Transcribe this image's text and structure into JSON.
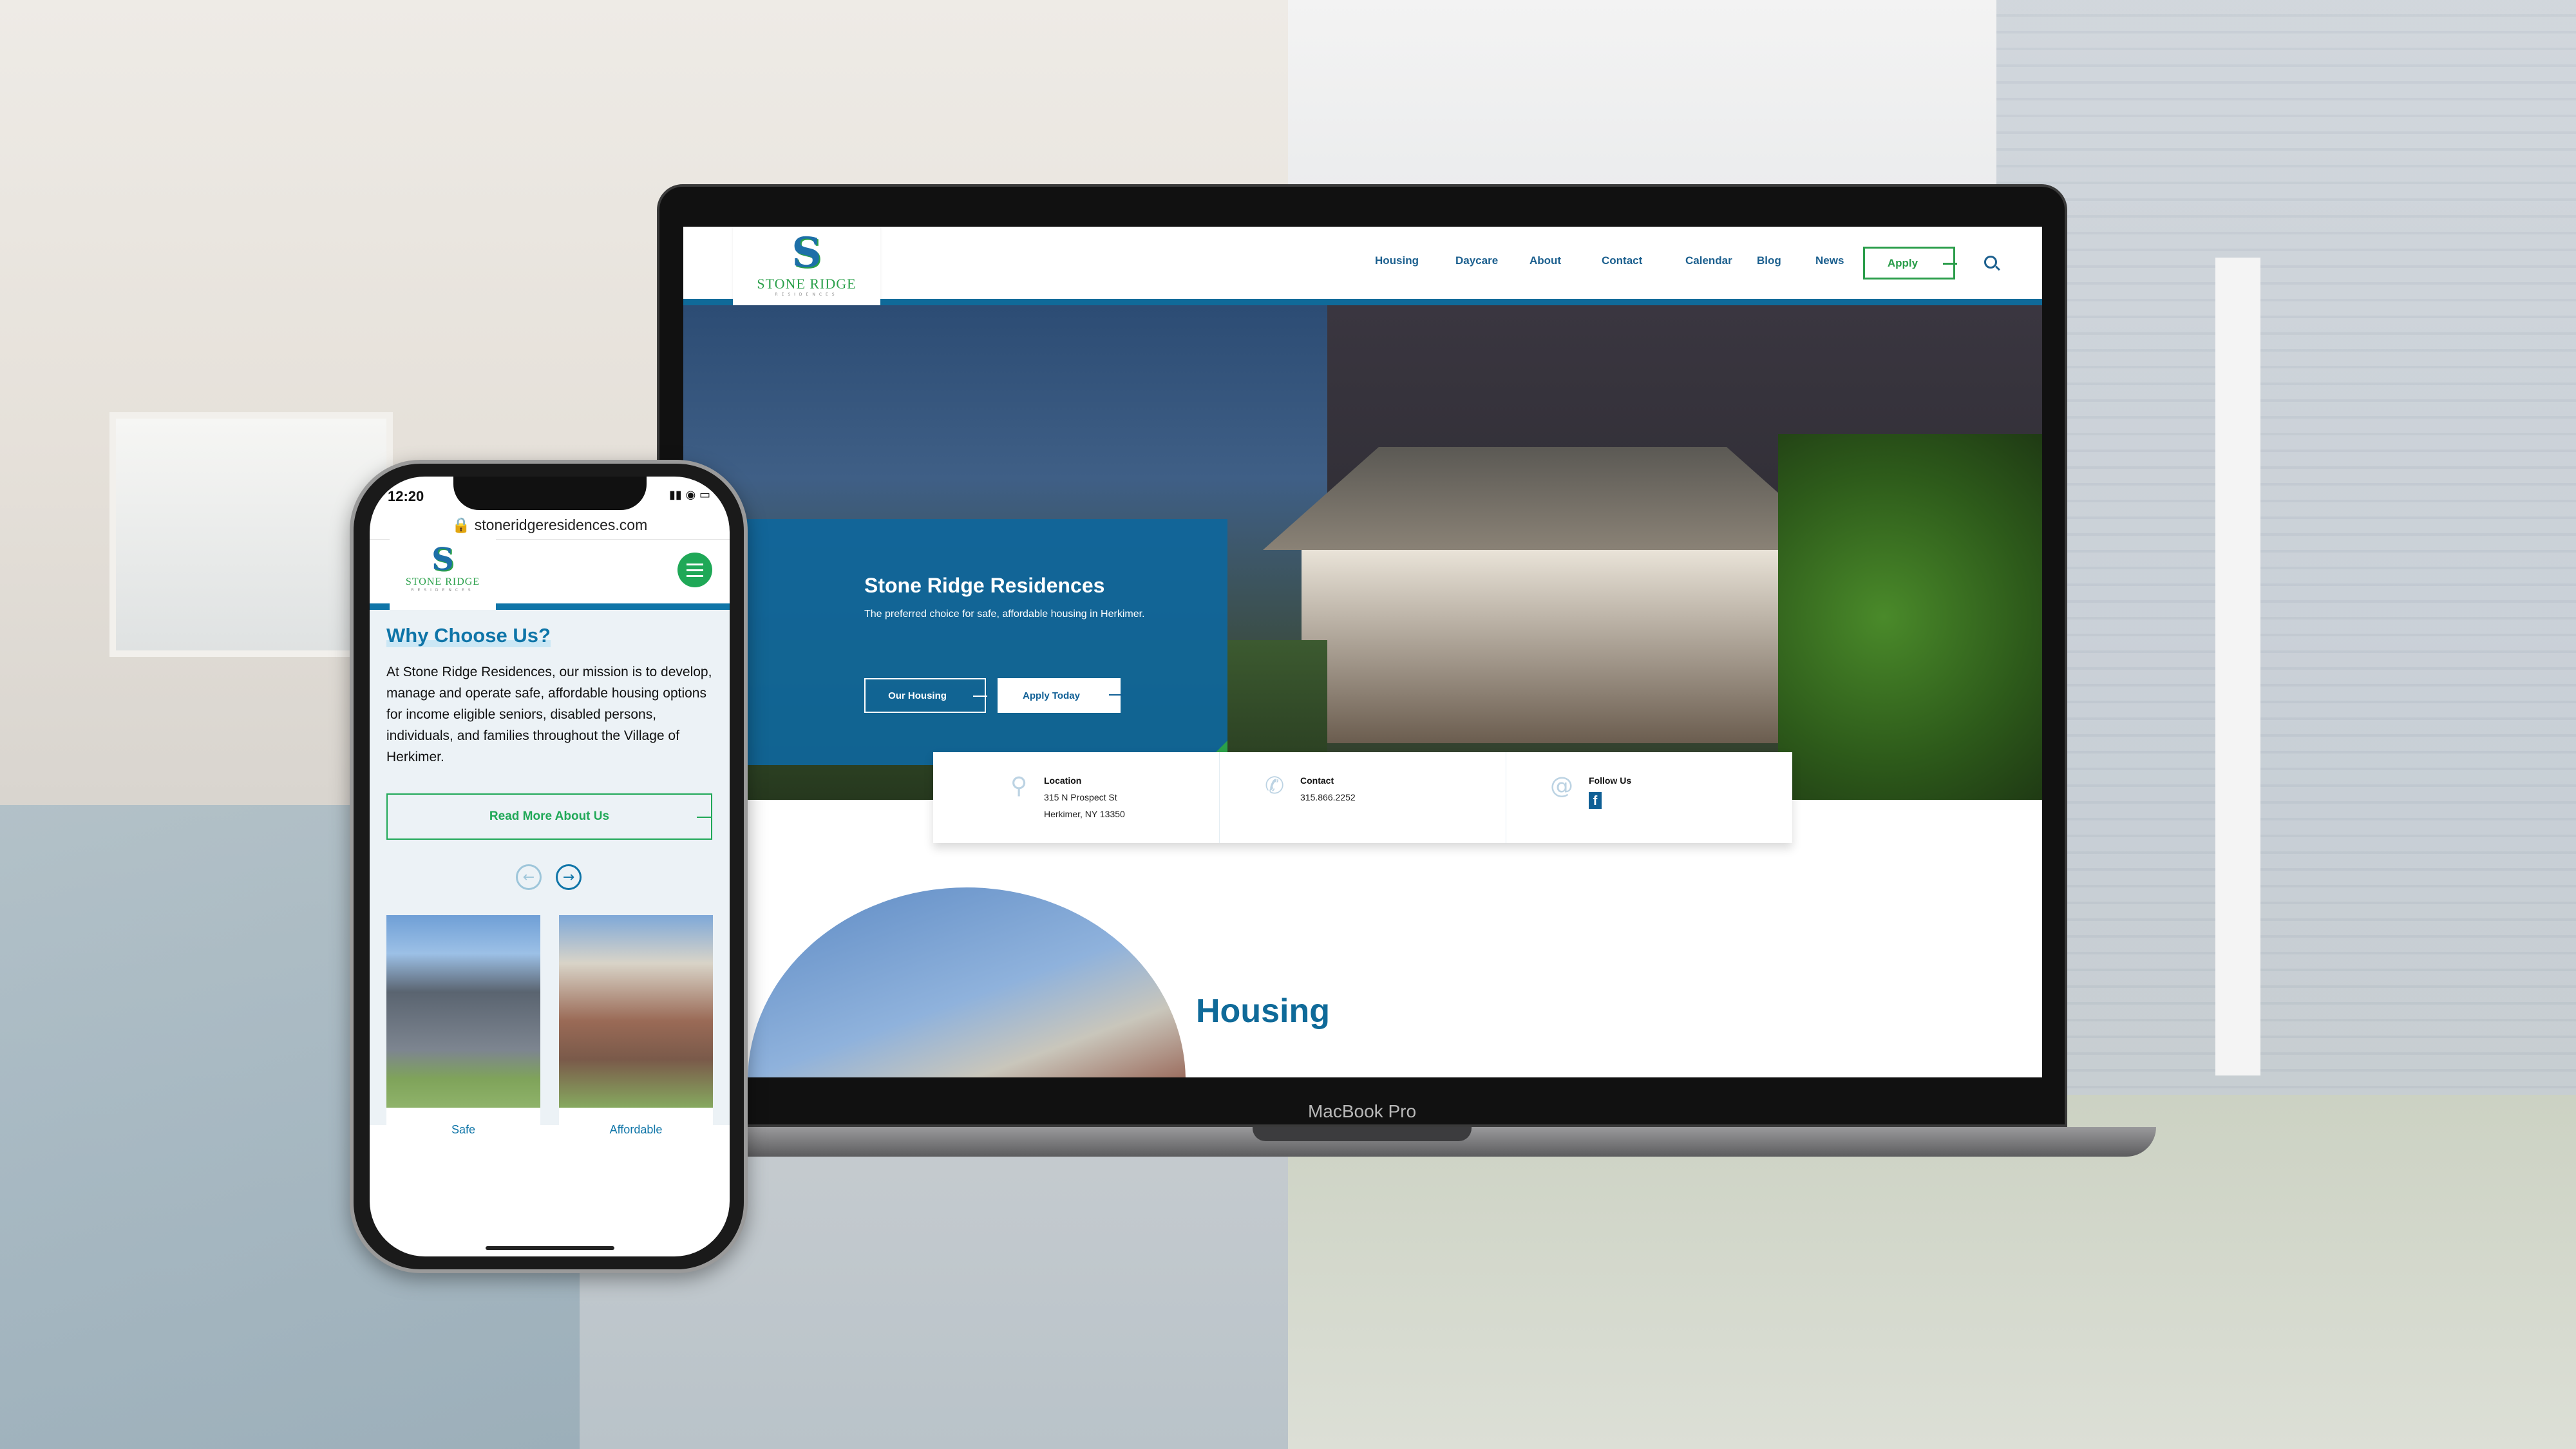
{
  "laptop": {
    "device_label": "MacBook Pro",
    "logo": {
      "name": "STONE RIDGE",
      "sub": "RESIDENCES"
    },
    "nav": {
      "items": [
        "Housing",
        "Daycare",
        "About",
        "Contact",
        "Calendar",
        "Blog",
        "News"
      ],
      "apply_label": "Apply",
      "search_icon": "search-icon"
    },
    "hero": {
      "title": "Stone Ridge Residences",
      "subtitle": "The preferred choice for safe, affordable housing in Herkimer.",
      "buttons": [
        "Our Housing",
        "Apply Today"
      ]
    },
    "info": [
      {
        "icon": "map-pin-icon",
        "title": "Location",
        "lines": [
          "315 N Prospect St",
          "Herkimer, NY 13350"
        ]
      },
      {
        "icon": "phone-icon",
        "title": "Contact",
        "lines": [
          "315.866.2252"
        ]
      },
      {
        "icon": "at-icon",
        "title": "Follow Us",
        "social": "facebook-icon"
      }
    ],
    "section_title": "Housing"
  },
  "phone": {
    "time": "12:20",
    "url": "stoneridgeresidences.com",
    "logo": {
      "name": "STONE RIDGE",
      "sub": "RESIDENCES"
    },
    "heading": "Why Choose Us?",
    "paragraph": "At Stone Ridge Residences, our mission is to develop, manage and operate safe, affordable housing options for income eligible seniors, disabled persons, individuals, and families throughout the Village of Herkimer.",
    "read_more": "Read More About Us",
    "cards": [
      "Safe",
      "Affordable"
    ]
  },
  "colors": {
    "primary_blue": "#0f6a99",
    "accent_green": "#2aa04a"
  }
}
